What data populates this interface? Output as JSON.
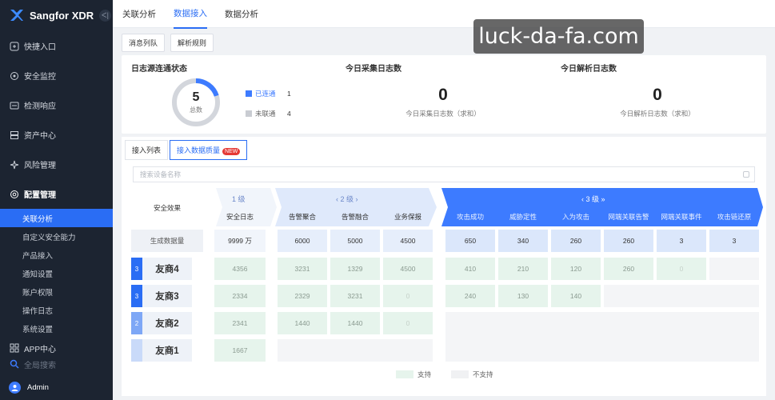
{
  "brand": {
    "name": "Sangfor XDR",
    "collapse": "ᐸ|"
  },
  "sidebar": {
    "items": [
      {
        "label": "快捷入口",
        "icon": "shortcut-icon"
      },
      {
        "label": "安全监控",
        "icon": "monitor-icon"
      },
      {
        "label": "检测响应",
        "icon": "detect-icon"
      },
      {
        "label": "资产中心",
        "icon": "asset-icon"
      },
      {
        "label": "风险管理",
        "icon": "risk-icon"
      }
    ],
    "config": {
      "label": "配置管理",
      "icon": "gear-icon"
    },
    "sub_items": [
      "关联分析",
      "自定义安全能力",
      "产品接入",
      "通知设置",
      "账户权限",
      "操作日志",
      "系统设置"
    ],
    "app_center": "APP中心",
    "global_search": "全局搜索",
    "admin": "Admin"
  },
  "top_tabs": [
    "关联分析",
    "数据接入",
    "数据分析"
  ],
  "watermark": "luck-da-fa.com",
  "sub_tabs": [
    "消息列队",
    "解析规则"
  ],
  "stats": {
    "source_title": "日志源连通状态",
    "total_num": "5",
    "total_label": "总数",
    "connected_label": "已连通",
    "connected_val": "1",
    "disconnected_label": "未联通",
    "disconnected_val": "4",
    "collect_title": "今日采集日志数",
    "collect_num": "0",
    "collect_label": "今日采集日志数（求和）",
    "parse_title": "今日解析日志数",
    "parse_num": "0",
    "parse_label": "今日解析日志数（求和）"
  },
  "quality": {
    "tabs": [
      "接入列表",
      "接入数据质量"
    ],
    "new_badge": "NEW",
    "search_placeholder": "搜索设备名称",
    "effect_label": "安全效果",
    "level1": "1 级",
    "level2": "‹ 2 级 ›",
    "level3": "‹ 3 级 »",
    "columns": [
      "安全日志",
      "告警聚合",
      "告警融合",
      "业务保报",
      "攻击成功",
      "威胁定性",
      "入为攻击",
      "网端关联告警",
      "网端关联事件",
      "攻击链还原"
    ],
    "gen_label": "生成数据量",
    "gen_values": [
      "9999 万",
      "6000",
      "5000",
      "4500",
      "650",
      "340",
      "260",
      "260",
      "3",
      "3"
    ],
    "rows": [
      {
        "tag": "3",
        "name": "友商4",
        "values": [
          "4356",
          "3231",
          "1329",
          "4500",
          "410",
          "210",
          "120",
          "260",
          "0"
        ]
      },
      {
        "tag": "3",
        "name": "友商3",
        "values": [
          "2334",
          "2329",
          "3231",
          "0",
          "240",
          "130",
          "140"
        ]
      },
      {
        "tag": "2",
        "name": "友商2",
        "values": [
          "2341",
          "1440",
          "1440",
          "0"
        ]
      },
      {
        "tag": "",
        "name": "友商1",
        "values": [
          "1667"
        ]
      }
    ],
    "legend_support": "支持",
    "legend_nosupport": "不支持"
  },
  "colors": {
    "accent": "#2a6df4",
    "sidebar": "#1c2431",
    "support": "#e6f4ec"
  }
}
